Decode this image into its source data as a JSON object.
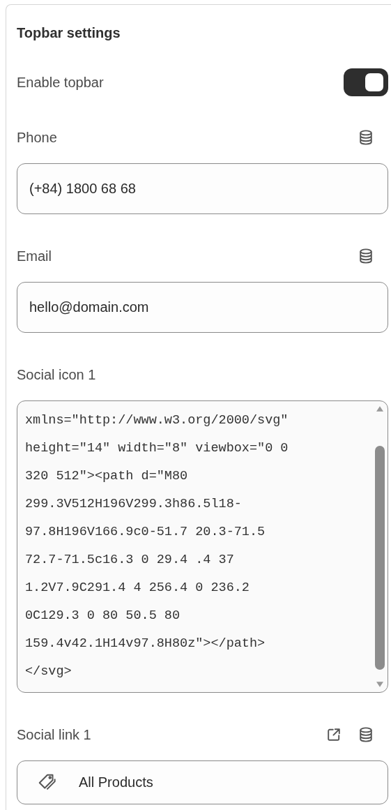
{
  "panel": {
    "title": "Topbar settings",
    "settings": [
      {
        "kind": "toggle",
        "label": "Enable topbar",
        "on": true
      },
      {
        "kind": "text",
        "label": "Phone",
        "value": "(+84) 1800 68 68"
      },
      {
        "kind": "text",
        "label": "Email",
        "value": "hello@domain.com"
      },
      {
        "kind": "code",
        "label": "Social icon 1",
        "value": "xmlns=\"http://www.w3.org/2000/svg\"\nheight=\"14\" width=\"8\" viewbox=\"0 0\n320 512\"><path d=\"M80\n299.3V512H196V299.3h86.5l18-\n97.8H196V166.9c0-51.7 20.3-71.5\n72.7-71.5c16.3 0 29.4 .4 37\n1.2V7.9C291.4 4 256.4 0 236.2\n0C129.3 0 80 50.5 80\n159.4v42.1H14v97.8H80z\"></path>\n</svg>"
      },
      {
        "kind": "link",
        "label": "Social link 1",
        "value": "All Products"
      }
    ]
  }
}
